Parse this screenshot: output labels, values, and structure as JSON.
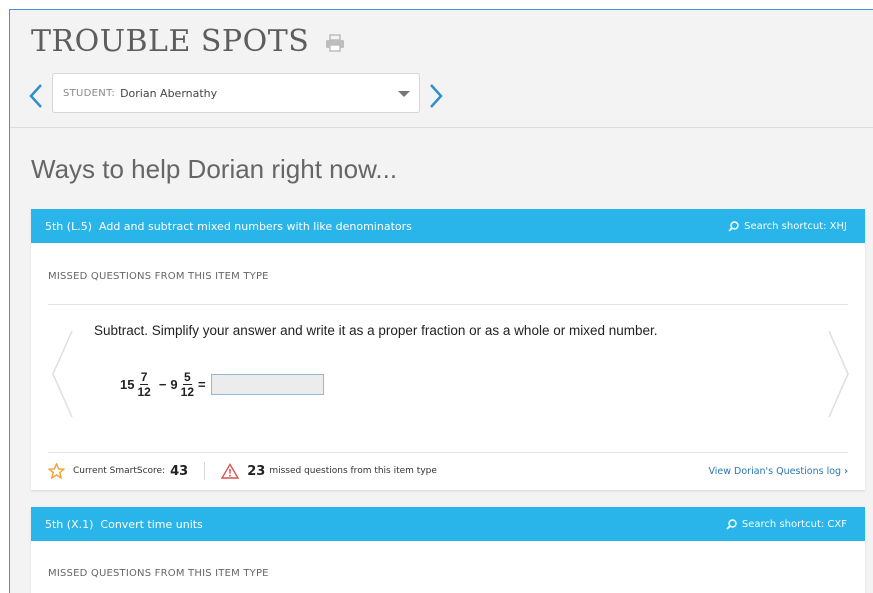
{
  "page": {
    "title": "TROUBLE SPOTS",
    "section_heading": "Ways to help Dorian right now..."
  },
  "student_selector": {
    "label": "STUDENT:",
    "value": "Dorian Abernathy"
  },
  "cards": [
    {
      "skill_code": "5th (L.5)",
      "skill_name": "Add and subtract mixed numbers with like denominators",
      "search_shortcut": "Search shortcut: XHJ",
      "missed_label": "MISSED QUESTIONS FROM THIS ITEM TYPE",
      "question": "Subtract. Simplify your answer and write it as a proper fraction or as a whole or mixed number.",
      "problem": {
        "whole1": "15",
        "num1": "7",
        "den1": "12",
        "operator": "−",
        "whole2": "9",
        "num2": "5",
        "den2": "12",
        "equals": "="
      },
      "smartscore_label": "Current SmartScore:",
      "smartscore_value": "43",
      "missed_count": "23",
      "missed_text": "missed questions from this item type",
      "log_link": "View Dorian's Questions log"
    },
    {
      "skill_code": "5th (X.1)",
      "skill_name": "Convert time units",
      "search_shortcut": "Search shortcut: CXF",
      "missed_label": "MISSED QUESTIONS FROM THIS ITEM TYPE"
    }
  ],
  "colors": {
    "header_blue": "#29b4ea",
    "nav_blue": "#2f8fd0",
    "star_orange": "#f0a030",
    "warning_red": "#d9534f",
    "link_blue": "#2a78b5"
  }
}
